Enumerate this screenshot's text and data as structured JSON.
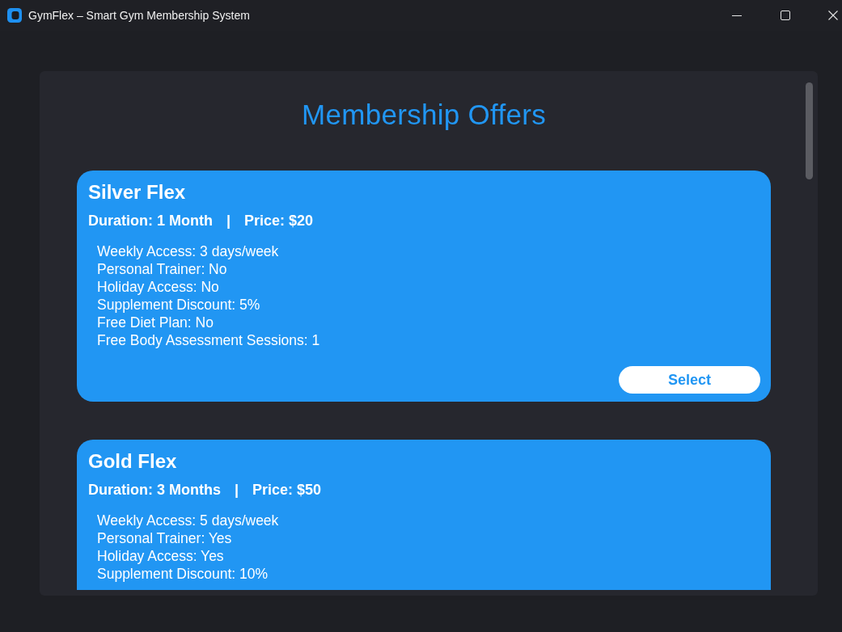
{
  "window": {
    "title": "GymFlex – Smart Gym Membership System"
  },
  "heading": "Membership Offers",
  "plans": [
    {
      "name": "Silver Flex",
      "duration": "Duration: 1 Month",
      "separator": "|",
      "price": "Price: $20",
      "features": [
        "Weekly Access: 3 days/week",
        "Personal Trainer: No",
        "Holiday Access: No",
        "Supplement Discount: 5%",
        "Free Diet Plan: No",
        "Free Body Assessment Sessions: 1"
      ],
      "action": "Select"
    },
    {
      "name": "Gold Flex",
      "duration": "Duration: 3 Months",
      "separator": "|",
      "price": "Price: $50",
      "features": [
        "Weekly Access: 5 days/week",
        "Personal Trainer: Yes",
        "Holiday Access: Yes",
        "Supplement Discount: 10%"
      ]
    }
  ]
}
